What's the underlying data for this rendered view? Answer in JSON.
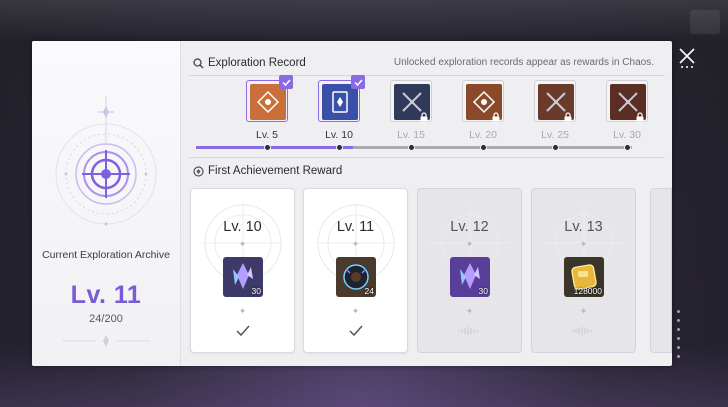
{
  "left_panel": {
    "archive_label": "Current Exploration Archive",
    "level_text": "Lv. 11",
    "progress_text": "24/200"
  },
  "exploration_record": {
    "title": "Exploration Record",
    "hint": "Unlocked exploration records appear as rewards in Chaos.",
    "items": [
      {
        "label": "Lv. 5",
        "state": "unlocked",
        "icon": "compass-card-icon",
        "color": "#c9703a"
      },
      {
        "label": "Lv. 10",
        "state": "unlocked",
        "icon": "card-deck-icon",
        "color": "#3a4fa8"
      },
      {
        "label": "Lv. 15",
        "state": "locked",
        "icon": "crossed-swords-icon",
        "color": "#2f3a5a"
      },
      {
        "label": "Lv. 20",
        "state": "locked",
        "icon": "compass-card-icon",
        "color": "#8a4a2a"
      },
      {
        "label": "Lv. 25",
        "state": "locked",
        "icon": "crossed-swords-icon",
        "color": "#6a3a2a"
      },
      {
        "label": "Lv. 30",
        "state": "locked",
        "icon": "crossed-swords-icon",
        "color": "#5a2e22"
      }
    ],
    "progress_fraction": 0.36
  },
  "first_achievement": {
    "title": "First Achievement Reward",
    "cards": [
      {
        "level": "Lv. 10",
        "qty": "30",
        "state": "claimed",
        "item_icon": "crystal-shard-icon",
        "item_color": "#3d3a6a"
      },
      {
        "level": "Lv. 11",
        "qty": "24",
        "state": "claimed",
        "item_icon": "dark-orb-icon",
        "item_color": "#4a3a2e"
      },
      {
        "level": "Lv. 12",
        "qty": "30",
        "state": "unclaimed",
        "item_icon": "crystal-shard-icon",
        "item_color": "#5a3f9a"
      },
      {
        "level": "Lv. 13",
        "qty": "128000",
        "state": "unclaimed",
        "item_icon": "gold-gem-icon",
        "item_color": "#3a3528"
      }
    ]
  },
  "colors": {
    "accent": "#8b6be3",
    "level": "#7a5bd6"
  }
}
